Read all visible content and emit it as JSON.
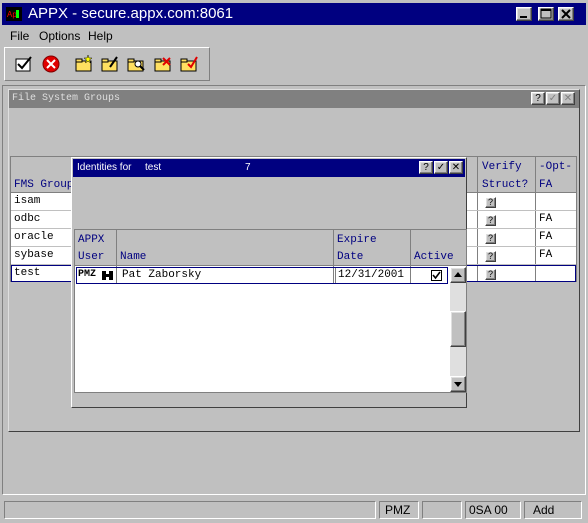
{
  "app": {
    "title": "APPX - secure.appx.com:8061",
    "min_glyph": "_",
    "max_glyph": "□",
    "close_glyph": "✕"
  },
  "menu": [
    {
      "label": "File"
    },
    {
      "label": "Options"
    },
    {
      "label": "Help"
    }
  ],
  "toolbar": {
    "icons": [
      "confirm-icon",
      "cancel-icon",
      "add-folder-icon",
      "change-folder-icon",
      "inquire-folder-icon",
      "delete-folder-icon",
      "scan-folder-icon"
    ]
  },
  "outer": {
    "title": "File System Groups",
    "help": "?",
    "ok": "✓",
    "close": "✕",
    "col_fms": "FMS Group",
    "col_verify_1": "Verify",
    "col_verify_2": "Struct?",
    "col_opt_1": "-Opt-",
    "col_opt_2": "FA",
    "rows": [
      {
        "name": "isam",
        "verify": "?",
        "opt": ""
      },
      {
        "name": "odbc",
        "verify": "?",
        "opt": "FA"
      },
      {
        "name": "oracle",
        "verify": "?",
        "opt": "FA"
      },
      {
        "name": "sybase",
        "verify": "?",
        "opt": "FA"
      },
      {
        "name": "test",
        "verify": "?",
        "opt": ""
      }
    ]
  },
  "dialog": {
    "title": "Identities for",
    "group": "test",
    "count": "7",
    "help": "?",
    "ok": "✓",
    "close": "✕",
    "hdr_appx": "APPX",
    "hdr_user": "User",
    "hdr_name": "Name",
    "hdr_expire_1": "Expire",
    "hdr_expire_2": "Date",
    "hdr_active": "Active",
    "rows": [
      {
        "user": "PMZ",
        "name": "Pat Zaborsky",
        "expire": "12/31/2001",
        "active": true
      }
    ]
  },
  "status": {
    "user": "PMZ",
    "db": "0SA 00",
    "mode": "Add"
  },
  "colors": {
    "titlebar": "#000080",
    "header_text": "#000080",
    "face": "#c0c0c0"
  }
}
